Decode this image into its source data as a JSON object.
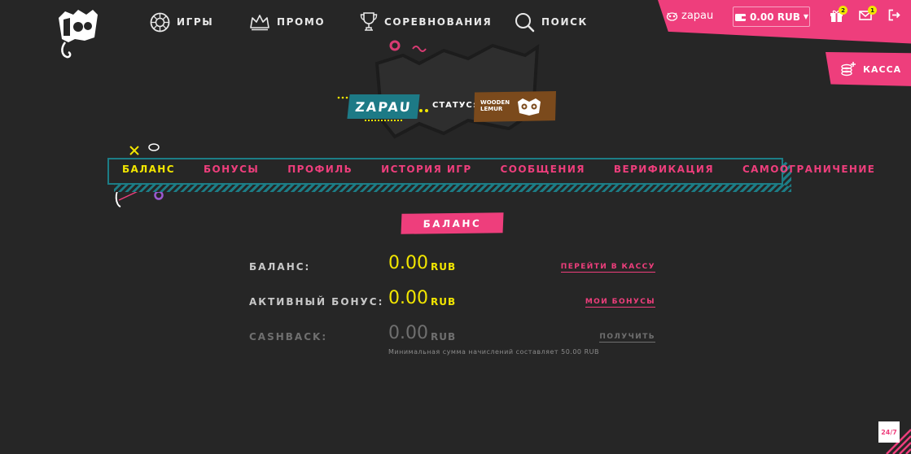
{
  "nav": {
    "games": "ИГРЫ",
    "promo": "ПРОМО",
    "tournaments": "СОРЕВНОВАНИЯ",
    "search": "ПОИСК"
  },
  "header": {
    "username": "zapau",
    "balance": "0.00 RUB",
    "gifts_count": "2",
    "messages_count": "1",
    "cashier": "КАССА"
  },
  "status": {
    "player_name": "ZAPAU",
    "label": "СТАТУС:",
    "level_line1": "WOODEN",
    "level_line2": "LEMUR"
  },
  "tabs": [
    {
      "label": "БАЛАНС",
      "active": true
    },
    {
      "label": "БОНУСЫ",
      "active": false
    },
    {
      "label": "ПРОФИЛЬ",
      "active": false
    },
    {
      "label": "ИСТОРИЯ ИГР",
      "active": false
    },
    {
      "label": "СООБЩЕНИЯ",
      "active": false
    },
    {
      "label": "ВЕРИФИКАЦИЯ",
      "active": false
    },
    {
      "label": "САМООГРАНИЧЕНИЕ",
      "active": false
    }
  ],
  "section_title": "БАЛАНС",
  "rows": [
    {
      "label": "БАЛАНС:",
      "value": "0.00",
      "currency": "RUB",
      "link": "ПЕРЕЙТИ В КАССУ"
    },
    {
      "label": "АКТИВНЫЙ БОНУС:",
      "value": "0.00",
      "currency": "RUB",
      "link": "МОИ БОНУСЫ"
    },
    {
      "label": "CASHBACK:",
      "value": "0.00",
      "currency": "RUB",
      "link": "ПОЛУЧИТЬ"
    }
  ],
  "cashback_note": "Минимальная сумма начислений составляет 50.00 RUB",
  "support_label": "24/7",
  "colors": {
    "background": "#262626",
    "accent_pink": "#ee3e7c",
    "accent_yellow": "#f2e600",
    "accent_teal": "#1c7d86",
    "status_brown": "#7b4a1c"
  }
}
